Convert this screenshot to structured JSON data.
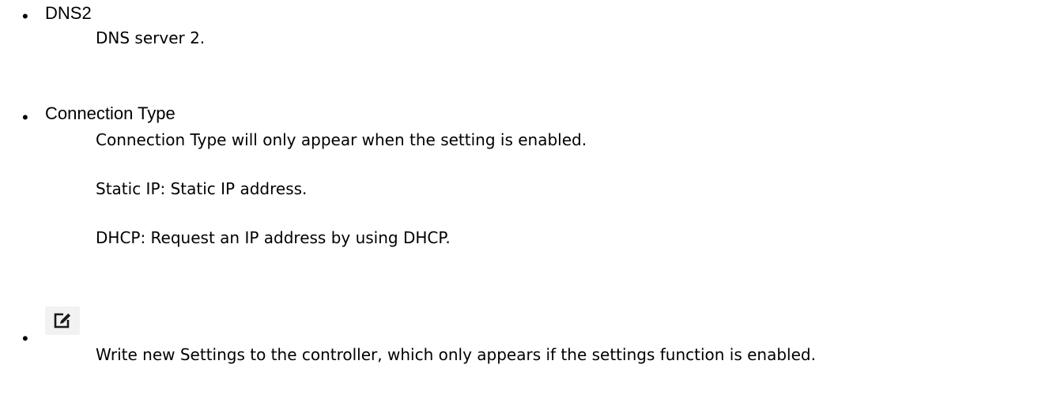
{
  "items": [
    {
      "term": "DNS2",
      "descriptions": [
        "DNS server 2."
      ]
    },
    {
      "term": "Connection Type",
      "descriptions": [
        "Connection Type will only appear when the setting is enabled.",
        "Static IP: Static IP address.",
        "DHCP: Request an IP address by using DHCP."
      ]
    },
    {
      "icon": "edit-icon",
      "descriptions": [
        "Write new Settings to the controller, which only appears if the settings function is enabled."
      ]
    }
  ]
}
